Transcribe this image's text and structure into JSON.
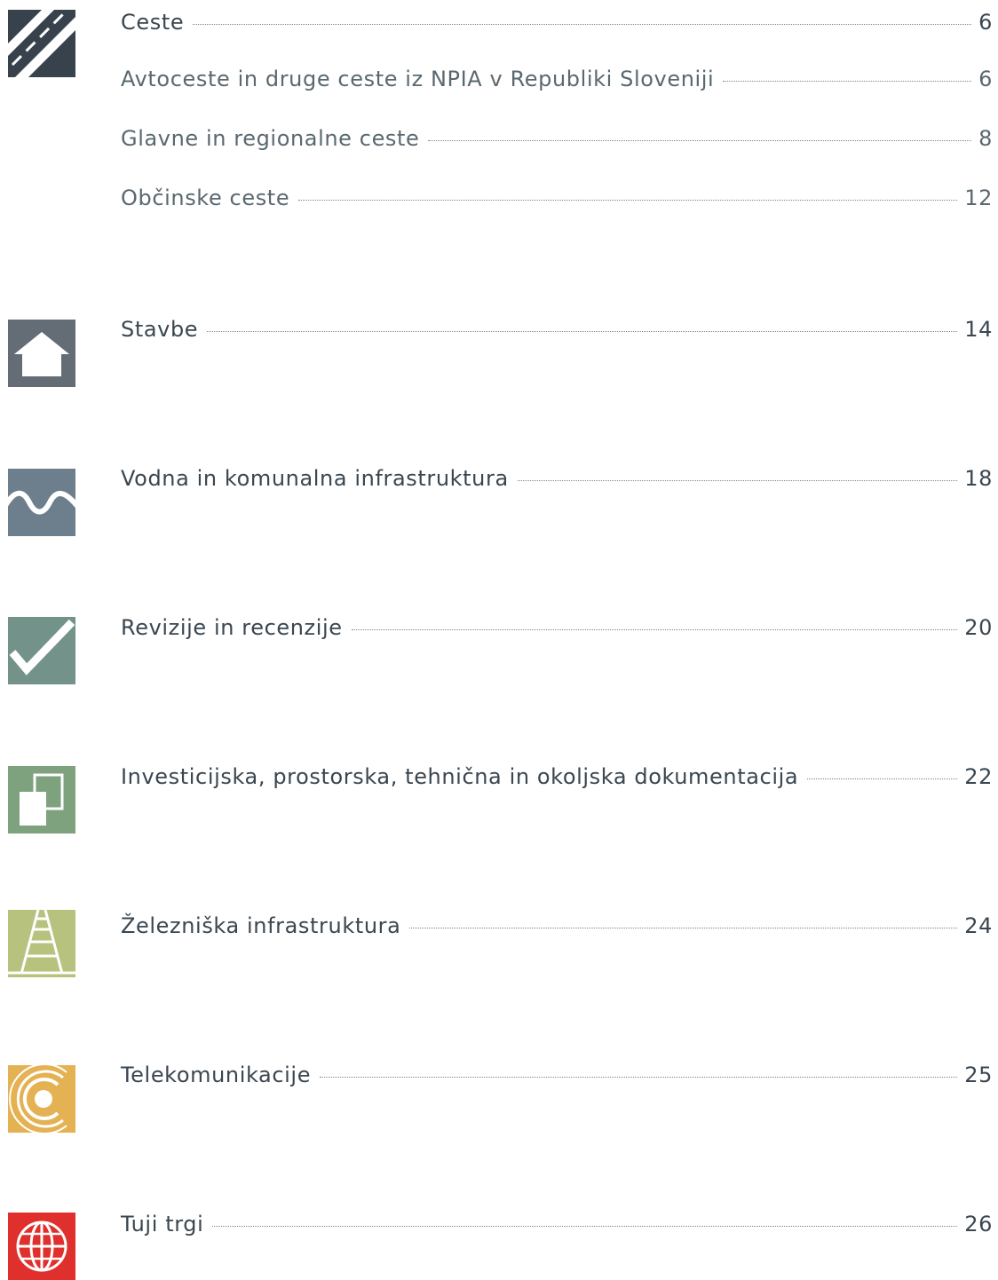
{
  "toc": [
    {
      "id": "ceste",
      "label": "Ceste",
      "page": "6",
      "icon": "road-icon",
      "color": "#38424c",
      "subs": [
        {
          "label": "Avtoceste in druge ceste iz NPIA v Republiki Sloveniji",
          "page": "6"
        },
        {
          "label": "Glavne in regionalne ceste",
          "page": "8"
        },
        {
          "label": "Občinske ceste",
          "page": "12"
        }
      ]
    },
    {
      "id": "stavbe",
      "label": "Stavbe",
      "page": "14",
      "icon": "house-icon",
      "color": "#646c75"
    },
    {
      "id": "vodna",
      "label": "Vodna in komunalna infrastruktura",
      "page": "18",
      "icon": "wave-icon",
      "color": "#6d7f8c"
    },
    {
      "id": "revizije",
      "label": "Revizije in recenzije",
      "page": "20",
      "icon": "checkmark-icon",
      "color": "#739289"
    },
    {
      "id": "investicijska",
      "label": "Investicijska, prostorska, tehnična in okoljska dokumentacija",
      "page": "22",
      "icon": "documents-icon",
      "color": "#7ea27d"
    },
    {
      "id": "zelezniska",
      "label": "Železniška infrastruktura",
      "page": "24",
      "icon": "railway-icon",
      "color": "#b6c27e"
    },
    {
      "id": "telekom",
      "label": "Telekomunikacije",
      "page": "25",
      "icon": "signal-icon",
      "color": "#e4b153"
    },
    {
      "id": "tuji",
      "label": "Tuji trgi",
      "page": "26",
      "icon": "globe-icon",
      "color": "#e0302e"
    }
  ]
}
